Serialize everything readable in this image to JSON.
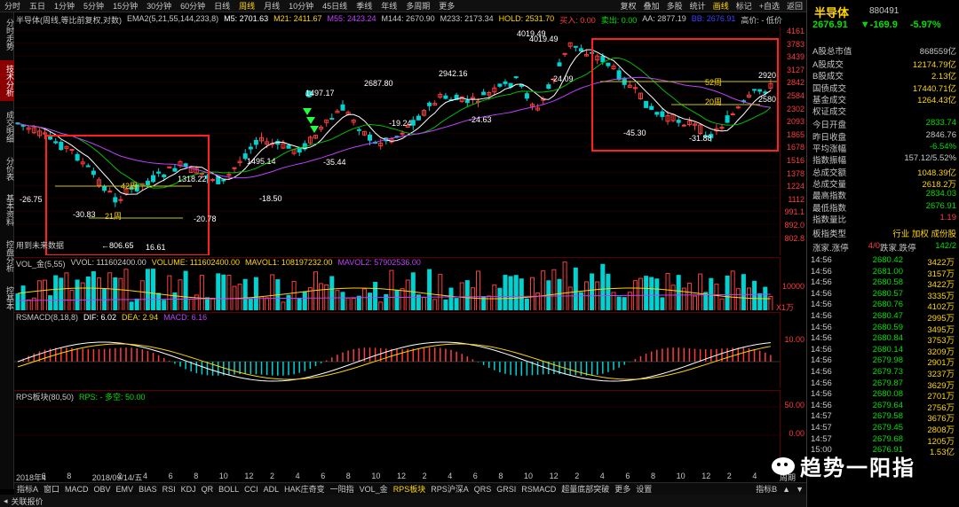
{
  "topbar": {
    "timeframes": [
      "分时",
      "五日",
      "1分钟",
      "5分钟",
      "15分钟",
      "30分钟",
      "60分钟",
      "日线",
      "周线",
      "月线",
      "10分钟",
      "45日线",
      "季线",
      "年线",
      "多周期",
      "更多"
    ],
    "active_timeframe": "周线",
    "right_buttons": [
      "复权",
      "叠加",
      "多股",
      "统计",
      "画线",
      "标记",
      "+自选",
      "返回"
    ],
    "active_right": "画线"
  },
  "leftbar": {
    "items": [
      "分时走势",
      "技术分析",
      "成交明细",
      "分价表",
      "基本资料",
      "控盘分析",
      "控基本"
    ],
    "active": "技术分析"
  },
  "main": {
    "title": "半导体(周线,等比前复权,对数)",
    "indicators": [
      {
        "label": "EMA2(5,21,55,144,233,8)",
        "color": "#c8c8c8"
      },
      {
        "label": "M5: 2701.63",
        "color": "#ffffff"
      },
      {
        "label": "M21: 2411.67",
        "color": "#ffd600"
      },
      {
        "label": "M55: 2423.24",
        "color": "#c040ff"
      },
      {
        "label": "M144: 2670.90",
        "color": "#c8c8c8"
      },
      {
        "label": "M233: 2173.34",
        "color": "#c8c8c8"
      },
      {
        "label": "HOLD: 2531.70",
        "color": "#ffd600"
      },
      {
        "label": "买入: 0.00",
        "color": "#ff3c3c"
      },
      {
        "label": "卖出: 0.00",
        "color": "#00e000"
      },
      {
        "label": "AA: 2877.19",
        "color": "#c8c8c8"
      },
      {
        "label": "BB: 2676.91",
        "color": "#4040ff"
      },
      {
        "label": "高价: - 低价",
        "color": "#c8c8c8"
      }
    ],
    "y_ticks": [
      "4161",
      "3783",
      "3439",
      "3127",
      "2842",
      "2584",
      "2302",
      "2093",
      "1865",
      "1678",
      "1516",
      "1378",
      "1224",
      "1112",
      "991.1",
      "892.0",
      "802.8"
    ],
    "price_annotations": [
      {
        "text": "-26.75"
      },
      {
        "text": "-30.83"
      },
      {
        "text": "←806.65"
      },
      {
        "text": "16.61"
      },
      {
        "text": "42周"
      },
      {
        "text": "21周"
      },
      {
        "text": "1318.22"
      },
      {
        "text": "-20.78"
      },
      {
        "text": "1495.14"
      },
      {
        "text": "-18.50"
      },
      {
        "text": "1497.17"
      },
      {
        "text": "-35.44"
      },
      {
        "text": "2687.80"
      },
      {
        "text": "-19.24"
      },
      {
        "text": "2942.16"
      },
      {
        "text": "-24.63"
      },
      {
        "text": "4019.49"
      },
      {
        "text": "4019.49"
      },
      {
        "text": "-24.09"
      },
      {
        "text": "-45.30"
      },
      {
        "text": "52周"
      },
      {
        "text": "20周"
      },
      {
        "text": "-31.88"
      },
      {
        "text": "2920"
      },
      {
        "text": "2580"
      }
    ],
    "future_label": "用到未来数据"
  },
  "vol": {
    "indicators": [
      {
        "label": "VOL_金(5,55)",
        "color": "#c8c8c8"
      },
      {
        "label": "VVOL: 111602400.00",
        "color": "#c8c8c8"
      },
      {
        "label": "VOLUME: 111602400.00",
        "color": "#ffd600"
      },
      {
        "label": "MAVOL1: 108197232.00",
        "color": "#ffd600"
      },
      {
        "label": "MAVOL2: 57902536.00",
        "color": "#c040ff"
      }
    ],
    "ticks": [
      "10000",
      "X1万"
    ]
  },
  "macd": {
    "indicators": [
      {
        "label": "RSMACD(8,18,8)",
        "color": "#c8c8c8"
      },
      {
        "label": "DIF: 6.02",
        "color": "#ffffff"
      },
      {
        "label": "DEA: 2.94",
        "color": "#ffd600"
      },
      {
        "label": "MACD: 6.16",
        "color": "#c040ff"
      }
    ],
    "ticks": [
      "10.00"
    ]
  },
  "rps": {
    "indicators": [
      {
        "label": "RPS板块(80,50)",
        "color": "#c8c8c8"
      },
      {
        "label": "RPS: - 多空: 50.00",
        "color": "#00e000"
      }
    ],
    "ticks": [
      "50.00",
      "0.00"
    ]
  },
  "xaxis": {
    "labels": [
      "2018年4",
      "6",
      "8",
      "2018/09/14/五",
      "2",
      "4",
      "6",
      "8",
      "10",
      "12",
      "2",
      "4",
      "6",
      "8",
      "10",
      "12",
      "2",
      "4",
      "6",
      "8",
      "10",
      "12",
      "2",
      "4",
      "6",
      "8",
      "10",
      "12",
      "2",
      "4"
    ],
    "right": "周期"
  },
  "tabs": {
    "items": [
      "指标A",
      "窗口",
      "MACD",
      "OBV",
      "EMV",
      "BIAS",
      "RSI",
      "KDJ",
      "QR",
      "BOLL",
      "CCI",
      "ADL",
      "HAK庄奇变",
      "一阳指",
      "VOL_金",
      "RPS板块",
      "RPS沪深A",
      "QRS",
      "GRSI",
      "RSMACD",
      "超量底部突破",
      "更多",
      "设置"
    ],
    "active": "RPS板块",
    "right": [
      "指标B",
      "▲",
      "▼"
    ]
  },
  "status": {
    "text": "关联报价"
  },
  "right": {
    "title": "半导体",
    "code": "880491",
    "price": "2676.91",
    "change": "▼-169.9",
    "pct": "-5.97%",
    "stats": [
      {
        "k": "A股总市值",
        "v": "868559亿",
        "c": "#c8c8c8"
      },
      {
        "k": "A股成交",
        "v": "12174.79亿",
        "c": "#ffd600"
      },
      {
        "k": "B股成交",
        "v": "2.13亿",
        "c": "#ffd600"
      },
      {
        "k": "国债成交",
        "v": "17440.71亿",
        "c": "#ffd600"
      },
      {
        "k": "基金成交",
        "v": "1264.43亿",
        "c": "#ffd600"
      },
      {
        "k": "权证成交",
        "v": "",
        "c": "#ffd600"
      },
      {
        "k": "今日开盘",
        "v": "2833.74",
        "c": "#00e000"
      },
      {
        "k": "昨日收盘",
        "v": "2846.76",
        "c": "#c8c8c8"
      },
      {
        "k": "平均涨幅",
        "v": "-6.54%",
        "c": "#00e000"
      },
      {
        "k": "指数振幅",
        "v": "157.12/5.52%",
        "c": "#c8c8c8"
      },
      {
        "k": "总成交额",
        "v": "1048.39亿",
        "c": "#ffd600"
      },
      {
        "k": "总成交量",
        "v": "2618.2万",
        "c": "#ffd600"
      },
      {
        "k": "最高指数",
        "v": "2834.03",
        "c": "#00e000"
      },
      {
        "k": "最低指数",
        "v": "2676.91",
        "c": "#00e000"
      },
      {
        "k": "指数量比",
        "v": "1.19",
        "c": "#ff3c3c"
      },
      {
        "k": "板指类型",
        "v": "行业 加权 成份股",
        "c": "#ffd600"
      },
      {
        "k": "涨家.涨停",
        "v": "4/0",
        "c": "#ff3c3c"
      }
    ],
    "fall_label": "跌家.跌停",
    "fall_value": "142/2",
    "ticks": [
      {
        "t": "14:56",
        "p": "2680.42",
        "v": "3422万"
      },
      {
        "t": "14:56",
        "p": "2681.00",
        "v": "3157万"
      },
      {
        "t": "14:56",
        "p": "2680.58",
        "v": "3422万"
      },
      {
        "t": "14:56",
        "p": "2680.57",
        "v": "3335万"
      },
      {
        "t": "14:56",
        "p": "2680.76",
        "v": "4102万"
      },
      {
        "t": "14:56",
        "p": "2680.47",
        "v": "2995万"
      },
      {
        "t": "14:56",
        "p": "2680.59",
        "v": "3495万"
      },
      {
        "t": "14:56",
        "p": "2680.84",
        "v": "3753万"
      },
      {
        "t": "14:56",
        "p": "2680.14",
        "v": "3209万"
      },
      {
        "t": "14:56",
        "p": "2679.98",
        "v": "2901万"
      },
      {
        "t": "14:56",
        "p": "2679.73",
        "v": "3237万"
      },
      {
        "t": "14:56",
        "p": "2679.87",
        "v": "3629万"
      },
      {
        "t": "14:56",
        "p": "2680.08",
        "v": "2701万"
      },
      {
        "t": "14:56",
        "p": "2679.64",
        "v": "2756万"
      },
      {
        "t": "14:57",
        "p": "2679.58",
        "v": "3676万"
      },
      {
        "t": "14:57",
        "p": "2679.45",
        "v": "2808万"
      },
      {
        "t": "14:57",
        "p": "2679.68",
        "v": "1205万"
      },
      {
        "t": "15:00",
        "p": "2676.91",
        "v": "1.53亿"
      }
    ],
    "watermark": "趋势一阳指"
  }
}
